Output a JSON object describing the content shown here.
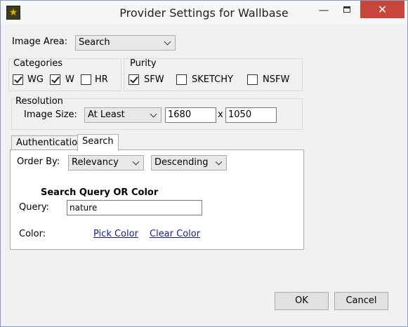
{
  "window": {
    "title": "Provider Settings for Wallbase",
    "icon": "star-icon"
  },
  "titlebar": {
    "minimize": "minimize-icon",
    "maximize": "maximize-icon",
    "close": "close-icon"
  },
  "image_area": {
    "label": "Image Area:",
    "value": "Search"
  },
  "categories": {
    "title": "Categories",
    "items": [
      {
        "label": "WG",
        "checked": true
      },
      {
        "label": "W",
        "checked": true
      },
      {
        "label": "HR",
        "checked": false
      }
    ]
  },
  "purity": {
    "title": "Purity",
    "items": [
      {
        "label": "SFW",
        "checked": true
      },
      {
        "label": "SKETCHY",
        "checked": false
      },
      {
        "label": "NSFW",
        "checked": false
      }
    ]
  },
  "resolution": {
    "title": "Resolution",
    "image_size_label": "Image Size:",
    "mode": "At Least",
    "width": "1680",
    "separator": "x",
    "height": "1050"
  },
  "tabs": [
    {
      "label": "Authentication",
      "active": false
    },
    {
      "label": "Search",
      "active": true
    }
  ],
  "search": {
    "order_by_label": "Order By:",
    "order_by": "Relevancy",
    "direction": "Descending",
    "section_title": "Search Query OR Color",
    "query_label": "Query:",
    "query_value": "nature",
    "color_label": "Color:",
    "pick_color": "Pick Color",
    "clear_color": "Clear Color"
  },
  "buttons": {
    "ok": "OK",
    "cancel": "Cancel"
  }
}
